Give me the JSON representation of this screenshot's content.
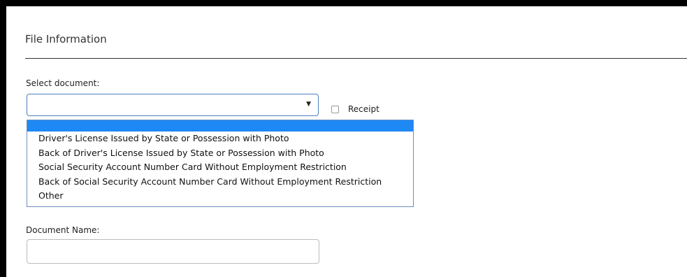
{
  "section": {
    "title": "File Information"
  },
  "document_select": {
    "label": "Select document:",
    "selected_value": "",
    "arrow_icon": "▼",
    "options": [
      "Driver's License Issued by State or Possession with Photo",
      "Back of Driver's License Issued by State or Possession with Photo",
      "Social Security Account Number Card Without Employment Restriction",
      "Back of Social Security Account Number Card Without Employment Restriction",
      "Other"
    ]
  },
  "receipt": {
    "label": "Receipt",
    "checked": false
  },
  "document_name": {
    "label": "Document Name:",
    "value": "",
    "placeholder": ""
  },
  "colors": {
    "highlight": "#1e88f5",
    "select_border": "#4a7fc0"
  }
}
